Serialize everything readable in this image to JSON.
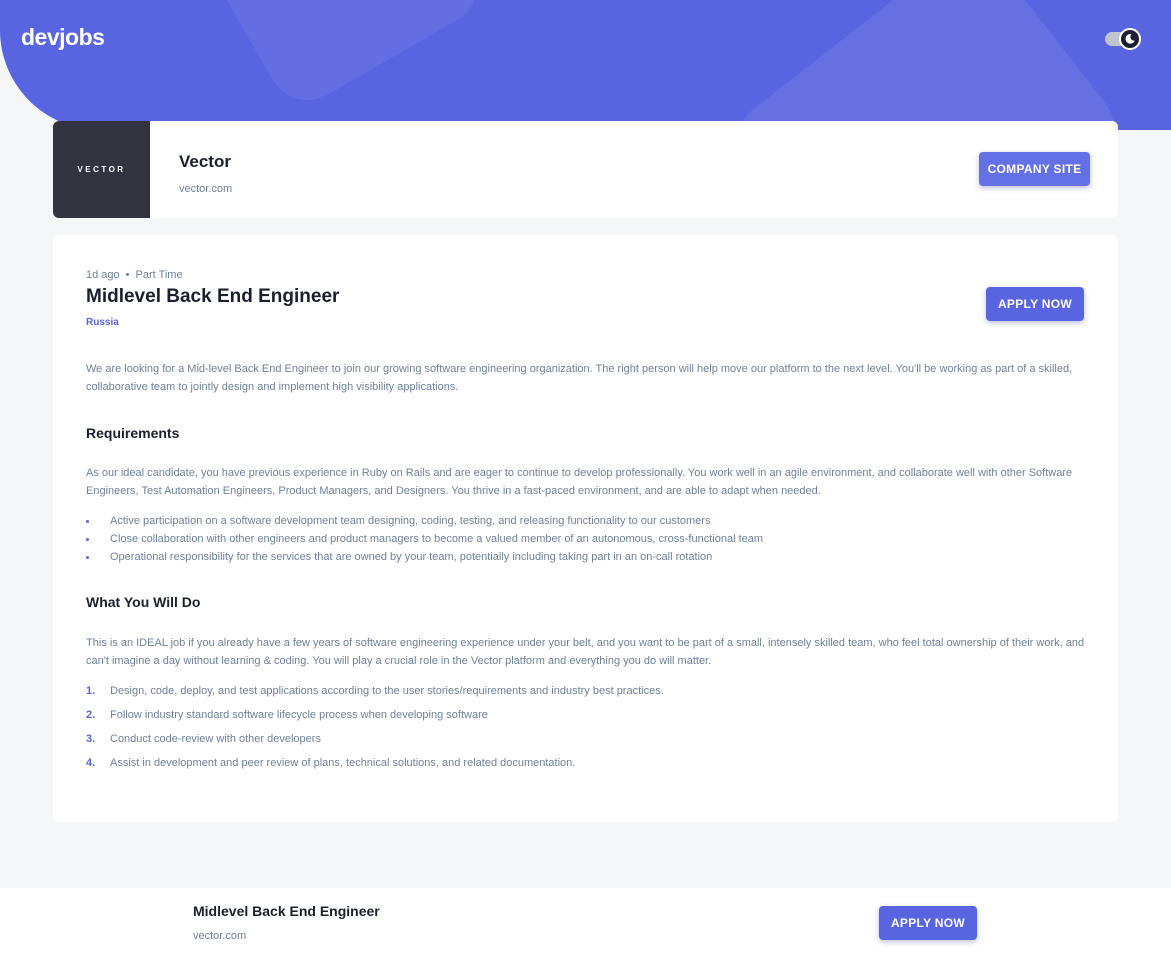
{
  "header": {
    "logo": "devjobs",
    "theme_toggle_state": "dark"
  },
  "company": {
    "logo_text": "VECTOR",
    "name": "Vector",
    "url": "vector.com",
    "site_button_label": "COMPANY SITE"
  },
  "job": {
    "posted": "1d ago",
    "separator": "•",
    "contract": "Part Time",
    "title": "Midlevel Back End Engineer",
    "location": "Russia",
    "apply_label": "APPLY NOW",
    "description": "We are looking for a Mid-level Back End Engineer to join our growing software engineering organization. The right person will help move our platform to the next level. You'll be working as part of a skilled, collaborative team to jointly design and implement high visibility applications.",
    "requirements": {
      "heading": "Requirements",
      "content": "As our ideal candidate, you have previous experience in Ruby on Rails and are eager to continue to develop professionally. You work well in an agile environment, and collaborate well with other Software Engineers, Test Automation Engineers, Product Managers, and Designers. You thrive in a fast-paced environment, and are able to adapt when needed.",
      "items": [
        "Active participation on a software development team designing, coding, testing, and releasing functionality to our customers",
        "Close collaboration with other engineers and product managers to become a valued member of an autonomous, cross-functional team",
        "Operational responsibility for the services that are owned by your team, potentially including taking part in an on-call rotation"
      ]
    },
    "role": {
      "heading": "What You Will Do",
      "content": "This is an IDEAL job if you already have a few years of software engineering experience under your belt, and you want to be part of a small, intensely skilled team, who feel total ownership of their work, and can't imagine a day without learning & coding. You will play a crucial role in the Vector platform and everything you do will matter.",
      "items": [
        {
          "num": "1.",
          "text": "Design, code, deploy, and test applications according to the user stories/requirements and industry best practices."
        },
        {
          "num": "2.",
          "text": "Follow industry standard software lifecycle process when developing software"
        },
        {
          "num": "3.",
          "text": "Conduct code-review with other developers"
        },
        {
          "num": "4.",
          "text": "Assist in development and peer review of plans, technical solutions, and related documentation."
        }
      ]
    }
  },
  "footer": {
    "title": "Midlevel Back End Engineer",
    "url": "vector.com",
    "apply_label": "APPLY NOW"
  },
  "colors": {
    "accent": "#5964e0",
    "heading": "#19202d",
    "body_text": "#6e8098",
    "background": "#f4f6f8"
  }
}
